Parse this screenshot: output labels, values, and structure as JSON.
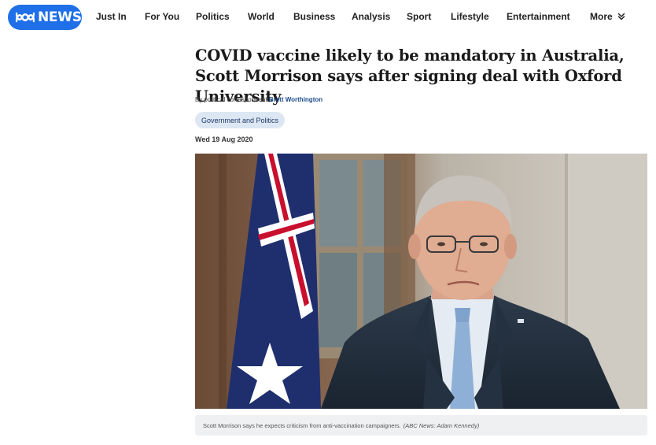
{
  "brand": {
    "logo_text": "NEWS",
    "brand_color": "#1e6fe8"
  },
  "nav": {
    "items": [
      "Just In",
      "For You",
      "Politics",
      "World",
      "Business",
      "Analysis",
      "Sport",
      "Lifestyle",
      "Entertainment"
    ],
    "more_label": "More",
    "more_icon": "chevron-double-down-icon"
  },
  "article": {
    "headline": "COVID vaccine likely to be mandatory in Australia, Scott Morrison says after signing deal with Oxford University",
    "byline_prefix": "By political correspondent",
    "author": "Brett Worthington",
    "tag": "Government and Politics",
    "date": "Wed 19 Aug 2020",
    "caption_text": "Scott Morrison says he expects criticism from anti-vaccination campaigners.",
    "caption_credit": "(ABC News: Adam Kennedy)"
  }
}
